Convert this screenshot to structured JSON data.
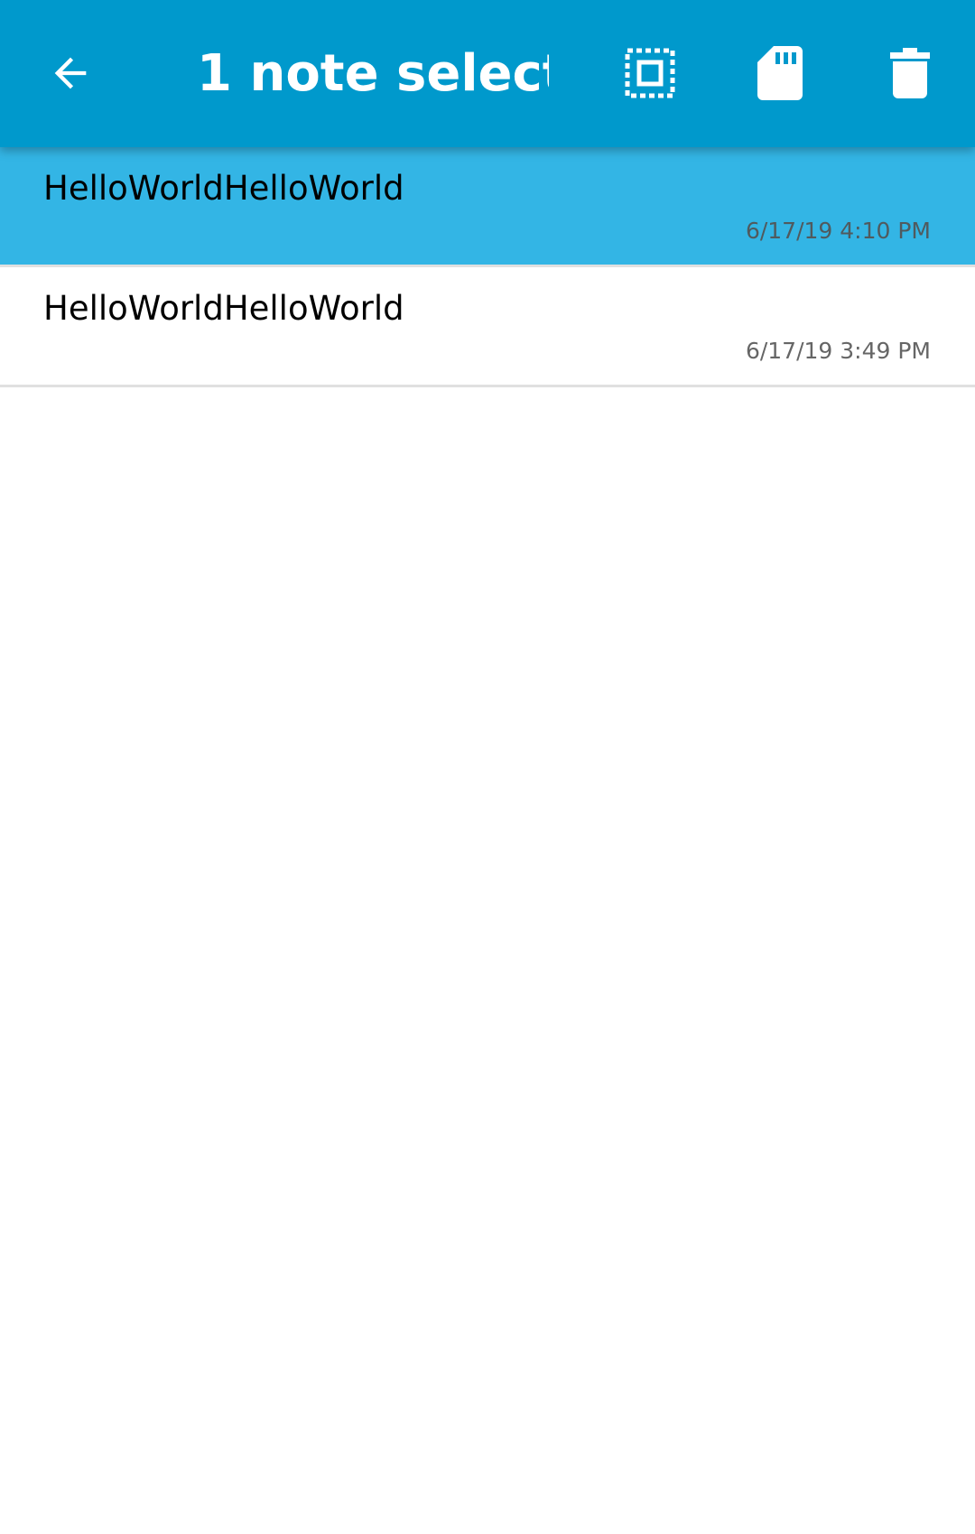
{
  "toolbar": {
    "title": "1 note select…",
    "background_color": "#0099cc",
    "icons": {
      "back": "arrow-back-icon",
      "select_all": "select-all-icon",
      "save_to_sd": "sd-card-icon",
      "delete": "trash-icon"
    }
  },
  "notes": [
    {
      "text": "HelloWorldHelloWorld",
      "date": "6/17/19 4:10 PM",
      "selected": true,
      "highlight_color": "#33b5e5"
    },
    {
      "text": "HelloWorldHelloWorld",
      "date": "6/17/19 3:49 PM",
      "selected": false
    }
  ]
}
